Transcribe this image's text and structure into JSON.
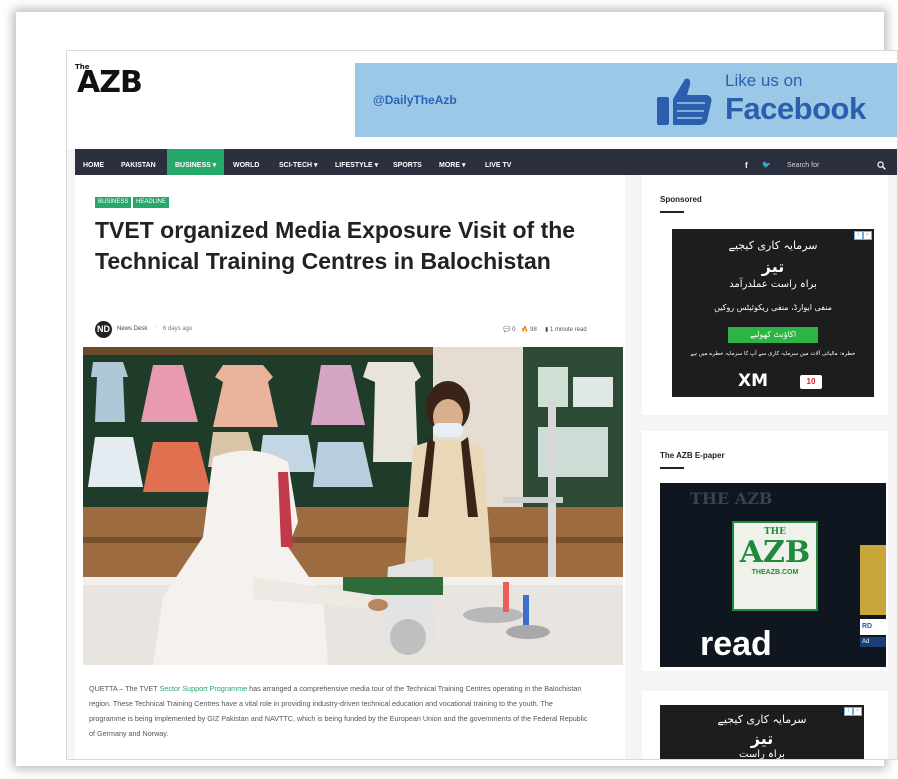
{
  "header": {
    "logo_small": "The",
    "logo_text": "AZB",
    "facebook_handle": "@DailyTheAzb",
    "facebook_like": "Like us on",
    "facebook_name": "Facebook"
  },
  "nav": {
    "items": [
      "HOME",
      "PAKISTAN",
      "BUSINESS ▾",
      "WORLD",
      "SCI-TECH ▾",
      "LIFESTYLE ▾",
      "SPORTS",
      "MORE ▾",
      "LIVE TV"
    ],
    "active_index": 2,
    "facebook_glyph": "f",
    "twitter_glyph": "🐦",
    "search_label": "Search for"
  },
  "article": {
    "tags": [
      "BUSINESS",
      "HEADLINE"
    ],
    "title": "TVET organized Media Exposure Visit of the Technical Training Centres in Balochistan",
    "author_initials": "ND",
    "author": "News Desk",
    "date": "6 days ago",
    "comments": "0",
    "views": "98",
    "read_time": "1 minute read",
    "body_before_link": "QUETTA – The TVET ",
    "body_link": "Sector Support Programme",
    "body_after_link": " has arranged a comprehensive media tour of the Technical Training Centres operating in the Balochistan region. These Technical Training Centres have a vital role in providing industry-driven technical education and vocational training to the youth. The programme is being implemented by GIZ Pakistan and NAVTTC, which is being funded by the European Union and the governments of the Federal Republic of Germany and Norway."
  },
  "sidebar": {
    "sponsored_title": "Sponsored",
    "ad": {
      "line1": "سرمایہ کاری کیجیے",
      "line2": "تیز",
      "line3": "براہ راست عملدرآمد",
      "line4": "منفی ایوارڈ، منفی ریکوئیٹس روکیں",
      "button": "اکاؤنٹ کھولیے",
      "disclaimer": "خطرہ: مالیاتی آلات میں سرمایہ کاری سے آپ کا سرمایہ خطرے میں ہے",
      "brand": "XM",
      "brand_badge": "10"
    },
    "epaper_title": "The AZB E-paper",
    "epaper": {
      "masthead": "THE AZB",
      "logo_top": "THE",
      "logo_main": "AZB",
      "logo_url": "THEAZB.COM",
      "read_text": "read",
      "side_badge": "RD",
      "side_ad": "Ad"
    },
    "ad2": {
      "line1": "سرمایہ کاری کیجیے",
      "line2": "تیز",
      "line3": "براہ راست"
    }
  },
  "colors": {
    "accent": "#25a86a",
    "nav_bg": "#2b2f3e",
    "facebook_blue": "#2b5fae",
    "banner_bg": "#9cc8e8"
  }
}
